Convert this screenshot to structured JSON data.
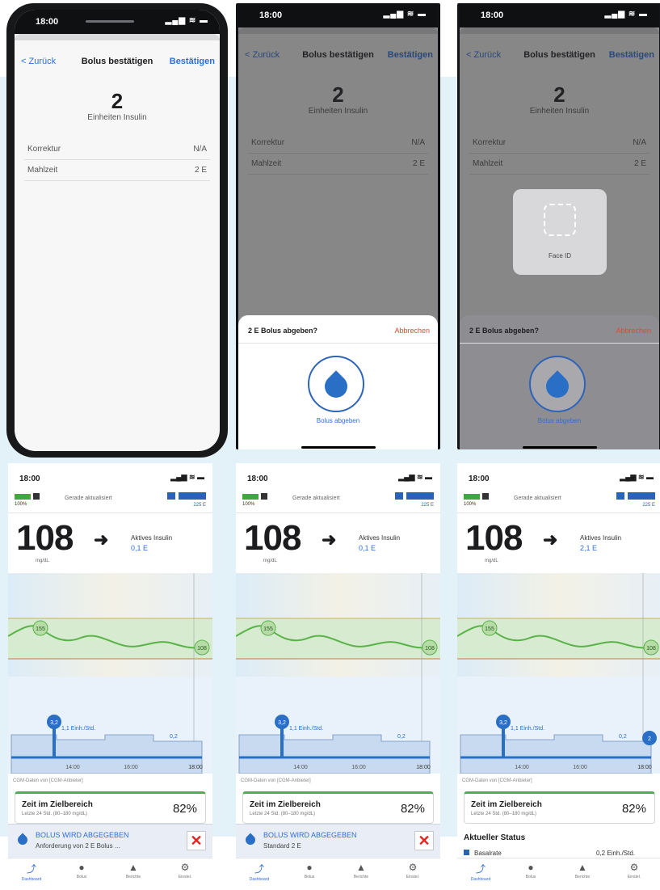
{
  "confirm": {
    "time": "18:00",
    "back_label": "< Zurück",
    "title": "Bolus bestätigen",
    "confirm_label": "Bestätigen",
    "amount": "2",
    "amount_unit": "Einheiten Insulin",
    "rows": [
      {
        "label": "Korrektur",
        "value": "N/A"
      },
      {
        "label": "Mahlzeit",
        "value": "2 E"
      }
    ]
  },
  "sheet": {
    "question": "2 E Bolus abgeben?",
    "cancel_label": "Abbrechen",
    "deliver_label": "Bolus abgeben"
  },
  "faceid": {
    "label": "Face ID"
  },
  "dashboard": {
    "time": "18:00",
    "pump_battery": "100%",
    "updated": "Gerade aktualisiert",
    "insulin_units": "225 E",
    "glucose": "108",
    "glucose_unit": "mg/dL",
    "active_insulin_label": "Aktives Insulin",
    "active_insulin_values": [
      "0,1 E",
      "0,1 E",
      "2,1 E"
    ],
    "chart_high": "155",
    "chart_current": "108",
    "basal_label": "1,1 Einh./Std.",
    "basal_end": "0,2",
    "bolus_marker": "3,2",
    "bolus_marker_new": "2",
    "x_ticks": [
      "14:00",
      "16:00",
      "18:00"
    ],
    "cgm_note": "CGM-Daten von [CGM-Anbieter]",
    "tir_title": "Zeit im Zielbereich",
    "tir_sub": "Letzte 24 Std. (80–180 mg/dL)",
    "tir_value": "82%",
    "banner_title": "BOLUS WIRD ABGEGEBEN",
    "banner_sub_1": "Anforderung von 2 E Bolus ...",
    "banner_sub_2": "Standard 2 E",
    "cancel_x": "✕",
    "status_heading": "Aktueller Status",
    "status_row_label": "Basalrate",
    "status_row_value": "0,2 Einh./Std.",
    "tabs": [
      {
        "label": "Dashboard",
        "icon": "chart-icon",
        "glyph": "⤴"
      },
      {
        "label": "Bolus",
        "icon": "drop-icon",
        "glyph": "●"
      },
      {
        "label": "Berichte",
        "icon": "bell-icon",
        "glyph": "▲"
      },
      {
        "label": "Einstel.",
        "icon": "gear-icon",
        "glyph": "⚙"
      }
    ]
  },
  "colors": {
    "accent": "#2f6fd4",
    "cancel": "#e2492f",
    "background": "#e3f1f8",
    "target_range": "#cfe8c8",
    "insulin": "#2a6fc6"
  }
}
